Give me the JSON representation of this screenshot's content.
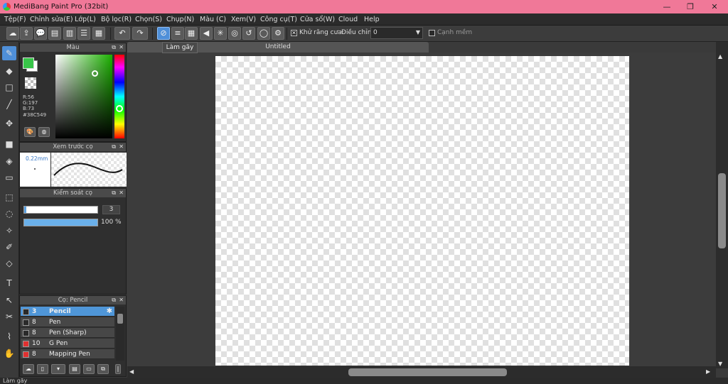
{
  "window": {
    "title": "MediBang Paint Pro (32bit)",
    "controls": {
      "minimize": "—",
      "maximize": "❐",
      "close": "✕"
    }
  },
  "menu": [
    "Tệp(F)",
    "Chỉnh sửa(E)",
    "Lớp(L)",
    "Bộ lọc(R)",
    "Chọn(S)",
    "Chụp(N)",
    "Màu (C)",
    "Xem(V)",
    "Công cụ(T)",
    "Cửa sổ(W)",
    "Cloud",
    "Help"
  ],
  "toolbar": {
    "antialias_label": "Khử răng cưa",
    "antialias_checked": true,
    "correction_label": "Điều chỉnh",
    "correction_value": "0",
    "edge_label": "Cạnh mềm",
    "edge_checked": false,
    "active_snap_tooltip": "Làm gãy"
  },
  "document": {
    "tab_title": "Untitled"
  },
  "color_panel": {
    "title": "Màu",
    "foreground": "#38C549",
    "background": "#ffffff",
    "r": "R:56",
    "g": "G:197",
    "b": "B:73",
    "hex": "#38C549"
  },
  "brush_preview": {
    "title": "Xem trước cọ",
    "size_label": "0.22mm"
  },
  "brush_control": {
    "title": "Kiểm soát cọ",
    "size_value": "3",
    "opacity_value": "100 %"
  },
  "brush_list": {
    "title": "Cọ: Pencil",
    "items": [
      {
        "size": "3",
        "name": "Pencil",
        "color": "#2a2a2a",
        "selected": true
      },
      {
        "size": "8",
        "name": "Pen",
        "color": "#2a2a2a",
        "selected": false
      },
      {
        "size": "8",
        "name": "Pen (Sharp)",
        "color": "#2a2a2a",
        "selected": false
      },
      {
        "size": "10",
        "name": "G Pen",
        "color": "#e03030",
        "selected": false
      },
      {
        "size": "8",
        "name": "Mapping Pen",
        "color": "#e03030",
        "selected": false
      }
    ]
  },
  "status": {
    "text": "Làm gãy"
  },
  "colors": {
    "title_bar": "#f07898",
    "accent": "#4f8fd8",
    "panel": "#333333"
  }
}
